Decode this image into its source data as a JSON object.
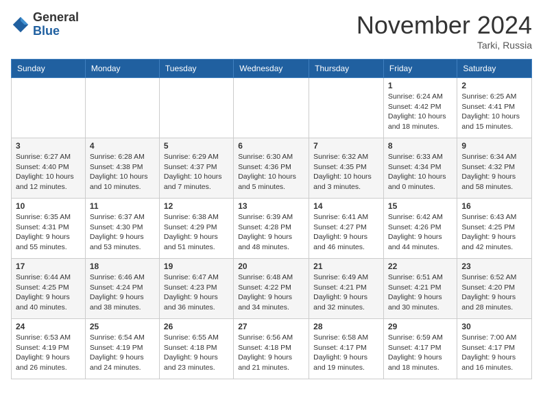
{
  "header": {
    "logo_general": "General",
    "logo_blue": "Blue",
    "month_title": "November 2024",
    "location": "Tarki, Russia"
  },
  "days_of_week": [
    "Sunday",
    "Monday",
    "Tuesday",
    "Wednesday",
    "Thursday",
    "Friday",
    "Saturday"
  ],
  "weeks": [
    [
      {
        "day": "",
        "info": ""
      },
      {
        "day": "",
        "info": ""
      },
      {
        "day": "",
        "info": ""
      },
      {
        "day": "",
        "info": ""
      },
      {
        "day": "",
        "info": ""
      },
      {
        "day": "1",
        "info": "Sunrise: 6:24 AM\nSunset: 4:42 PM\nDaylight: 10 hours\nand 18 minutes."
      },
      {
        "day": "2",
        "info": "Sunrise: 6:25 AM\nSunset: 4:41 PM\nDaylight: 10 hours\nand 15 minutes."
      }
    ],
    [
      {
        "day": "3",
        "info": "Sunrise: 6:27 AM\nSunset: 4:40 PM\nDaylight: 10 hours\nand 12 minutes."
      },
      {
        "day": "4",
        "info": "Sunrise: 6:28 AM\nSunset: 4:38 PM\nDaylight: 10 hours\nand 10 minutes."
      },
      {
        "day": "5",
        "info": "Sunrise: 6:29 AM\nSunset: 4:37 PM\nDaylight: 10 hours\nand 7 minutes."
      },
      {
        "day": "6",
        "info": "Sunrise: 6:30 AM\nSunset: 4:36 PM\nDaylight: 10 hours\nand 5 minutes."
      },
      {
        "day": "7",
        "info": "Sunrise: 6:32 AM\nSunset: 4:35 PM\nDaylight: 10 hours\nand 3 minutes."
      },
      {
        "day": "8",
        "info": "Sunrise: 6:33 AM\nSunset: 4:34 PM\nDaylight: 10 hours\nand 0 minutes."
      },
      {
        "day": "9",
        "info": "Sunrise: 6:34 AM\nSunset: 4:32 PM\nDaylight: 9 hours\nand 58 minutes."
      }
    ],
    [
      {
        "day": "10",
        "info": "Sunrise: 6:35 AM\nSunset: 4:31 PM\nDaylight: 9 hours\nand 55 minutes."
      },
      {
        "day": "11",
        "info": "Sunrise: 6:37 AM\nSunset: 4:30 PM\nDaylight: 9 hours\nand 53 minutes."
      },
      {
        "day": "12",
        "info": "Sunrise: 6:38 AM\nSunset: 4:29 PM\nDaylight: 9 hours\nand 51 minutes."
      },
      {
        "day": "13",
        "info": "Sunrise: 6:39 AM\nSunset: 4:28 PM\nDaylight: 9 hours\nand 48 minutes."
      },
      {
        "day": "14",
        "info": "Sunrise: 6:41 AM\nSunset: 4:27 PM\nDaylight: 9 hours\nand 46 minutes."
      },
      {
        "day": "15",
        "info": "Sunrise: 6:42 AM\nSunset: 4:26 PM\nDaylight: 9 hours\nand 44 minutes."
      },
      {
        "day": "16",
        "info": "Sunrise: 6:43 AM\nSunset: 4:25 PM\nDaylight: 9 hours\nand 42 minutes."
      }
    ],
    [
      {
        "day": "17",
        "info": "Sunrise: 6:44 AM\nSunset: 4:25 PM\nDaylight: 9 hours\nand 40 minutes."
      },
      {
        "day": "18",
        "info": "Sunrise: 6:46 AM\nSunset: 4:24 PM\nDaylight: 9 hours\nand 38 minutes."
      },
      {
        "day": "19",
        "info": "Sunrise: 6:47 AM\nSunset: 4:23 PM\nDaylight: 9 hours\nand 36 minutes."
      },
      {
        "day": "20",
        "info": "Sunrise: 6:48 AM\nSunset: 4:22 PM\nDaylight: 9 hours\nand 34 minutes."
      },
      {
        "day": "21",
        "info": "Sunrise: 6:49 AM\nSunset: 4:21 PM\nDaylight: 9 hours\nand 32 minutes."
      },
      {
        "day": "22",
        "info": "Sunrise: 6:51 AM\nSunset: 4:21 PM\nDaylight: 9 hours\nand 30 minutes."
      },
      {
        "day": "23",
        "info": "Sunrise: 6:52 AM\nSunset: 4:20 PM\nDaylight: 9 hours\nand 28 minutes."
      }
    ],
    [
      {
        "day": "24",
        "info": "Sunrise: 6:53 AM\nSunset: 4:19 PM\nDaylight: 9 hours\nand 26 minutes."
      },
      {
        "day": "25",
        "info": "Sunrise: 6:54 AM\nSunset: 4:19 PM\nDaylight: 9 hours\nand 24 minutes."
      },
      {
        "day": "26",
        "info": "Sunrise: 6:55 AM\nSunset: 4:18 PM\nDaylight: 9 hours\nand 23 minutes."
      },
      {
        "day": "27",
        "info": "Sunrise: 6:56 AM\nSunset: 4:18 PM\nDaylight: 9 hours\nand 21 minutes."
      },
      {
        "day": "28",
        "info": "Sunrise: 6:58 AM\nSunset: 4:17 PM\nDaylight: 9 hours\nand 19 minutes."
      },
      {
        "day": "29",
        "info": "Sunrise: 6:59 AM\nSunset: 4:17 PM\nDaylight: 9 hours\nand 18 minutes."
      },
      {
        "day": "30",
        "info": "Sunrise: 7:00 AM\nSunset: 4:17 PM\nDaylight: 9 hours\nand 16 minutes."
      }
    ]
  ]
}
